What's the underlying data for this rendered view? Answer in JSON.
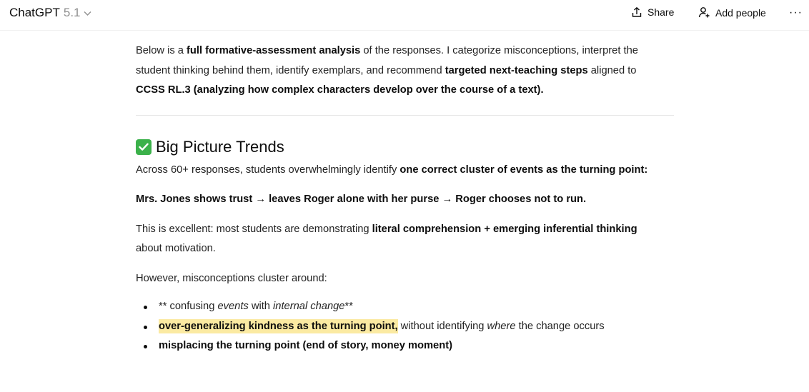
{
  "header": {
    "model_name": "ChatGPT",
    "model_version": "5.1",
    "share_label": "Share",
    "add_people_label": "Add people",
    "more_label": "···"
  },
  "intro": {
    "t1": "Below is a ",
    "b1": "full formative-assessment analysis",
    "t2": " of the responses. I categorize misconceptions, interpret the student thinking behind them, identify exemplars, and recommend ",
    "b2": "targeted next-teaching steps",
    "t3": " aligned to ",
    "b3": "CCSS RL.3 (analyzing how complex characters develop over the course of a text)."
  },
  "section": {
    "heading": "Big Picture Trends",
    "icon": "check-mark-icon",
    "accent": "#3bb14a"
  },
  "p1": {
    "t1": "Across 60+ responses, students overwhelmingly identify ",
    "b1": "one correct cluster of events as the turning point:"
  },
  "p2": {
    "b1": "Mrs. Jones shows trust → leaves Roger alone with her purse → Roger chooses not to run."
  },
  "p3": {
    "t1": "This is excellent: most students are demonstrating ",
    "b1": "literal comprehension + emerging inferential thinking",
    "t2": " about motivation."
  },
  "p4": {
    "t1": "However, misconceptions cluster around:"
  },
  "bullets": [
    {
      "t1": "** confusing ",
      "i1": "events",
      "t2": " with ",
      "i2": "internal change",
      "t3": "**"
    },
    {
      "hl": "over-generalizing kindness as the turning point,",
      "t1": " without identifying ",
      "i1": "where",
      "t2": " the change occurs"
    },
    {
      "b1": "misplacing the turning point (end of story, money moment)"
    }
  ],
  "colors": {
    "highlight": "#fbeaa2",
    "text": "#0d0d0d"
  }
}
